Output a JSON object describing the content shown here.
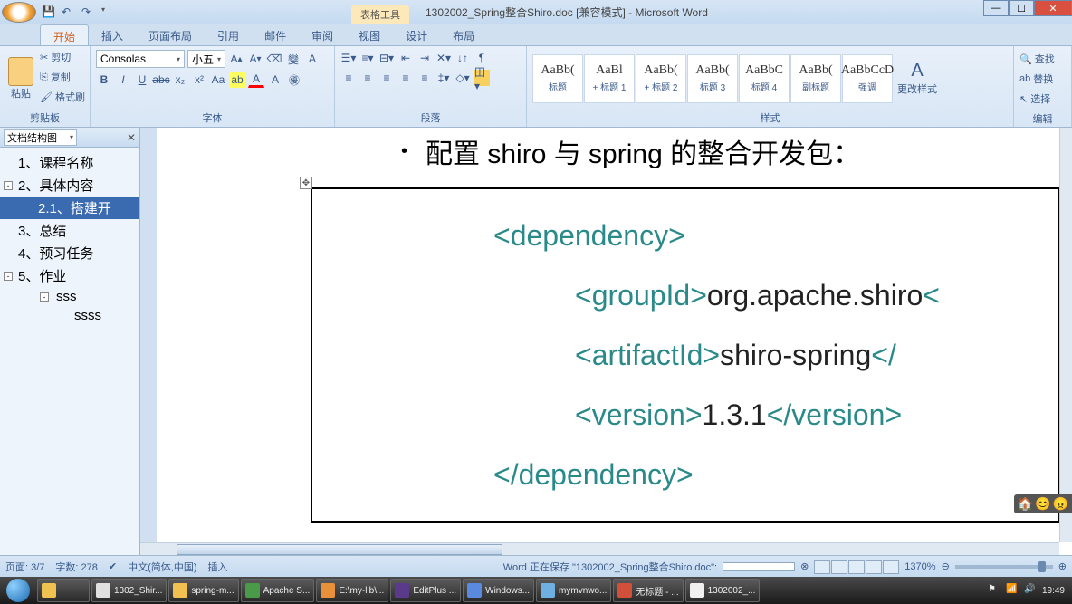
{
  "title": {
    "context_tab": "表格工具",
    "doc_title": "1302002_Spring整合Shiro.doc [兼容模式] - Microsoft Word"
  },
  "ribbon_tabs": [
    "开始",
    "插入",
    "页面布局",
    "引用",
    "邮件",
    "审阅",
    "视图",
    "设计",
    "布局"
  ],
  "ribbon_active": 0,
  "clipboard": {
    "paste": "粘贴",
    "cut": "剪切",
    "copy": "复制",
    "format_painter": "格式刷",
    "group": "剪贴板"
  },
  "font": {
    "name": "Consolas",
    "size": "小五",
    "group": "字体"
  },
  "paragraph": {
    "group": "段落"
  },
  "styles": {
    "items": [
      {
        "preview": "AaBb(",
        "name": "标题"
      },
      {
        "preview": "AaBl",
        "name": "+ 标题 1"
      },
      {
        "preview": "AaBb(",
        "name": "+ 标题 2"
      },
      {
        "preview": "AaBb(",
        "name": "标题 3"
      },
      {
        "preview": "AaBbC",
        "name": "标题 4"
      },
      {
        "preview": "AaBb(",
        "name": "副标题"
      },
      {
        "preview": "AaBbCcD",
        "name": "强调"
      }
    ],
    "change": "更改样式",
    "group": "样式"
  },
  "editing": {
    "find": "查找",
    "replace": "替换",
    "select": "选择",
    "group": "编辑"
  },
  "nav": {
    "header": "文档结构图",
    "items": [
      {
        "level": 1,
        "text": "1、课程名称"
      },
      {
        "level": 1,
        "text": "2、具体内容",
        "expanded": true
      },
      {
        "level": 2,
        "text": "2.1、搭建开",
        "selected": true
      },
      {
        "level": 1,
        "text": "3、总结"
      },
      {
        "level": 1,
        "text": "4、预习任务"
      },
      {
        "level": 1,
        "text": "5、作业",
        "expanded": true
      },
      {
        "level": 3,
        "text": "sss",
        "expanded": true
      },
      {
        "level": 4,
        "text": "ssss"
      }
    ]
  },
  "document": {
    "bullet_text": "配置 shiro 与 spring 的整合开发包：",
    "code": {
      "dep_open": "<dependency>",
      "group_open": "<groupId>",
      "group_val": "org.apache.shiro",
      "artifact_open": "<artifactId>",
      "artifact_val": "shiro-spring",
      "version_open": "<version>",
      "version_val": "1.3.1",
      "version_close": "</version>",
      "dep_close": "</dependency>"
    }
  },
  "status": {
    "page": "页面: 3/7",
    "words": "字数: 278",
    "lang": "中文(简体,中国)",
    "mode": "插入",
    "saving": "Word 正在保存 \"1302002_Spring整合Shiro.doc\":",
    "zoom": "1370%"
  },
  "taskbar": {
    "items": [
      "1302_Shir...",
      "spring-m...",
      "Apache S...",
      "E:\\my-lib\\...",
      "EditPlus ...",
      "Windows...",
      "mymvnwo...",
      "无标题 - ...",
      "1302002_..."
    ],
    "time": "19:49"
  }
}
